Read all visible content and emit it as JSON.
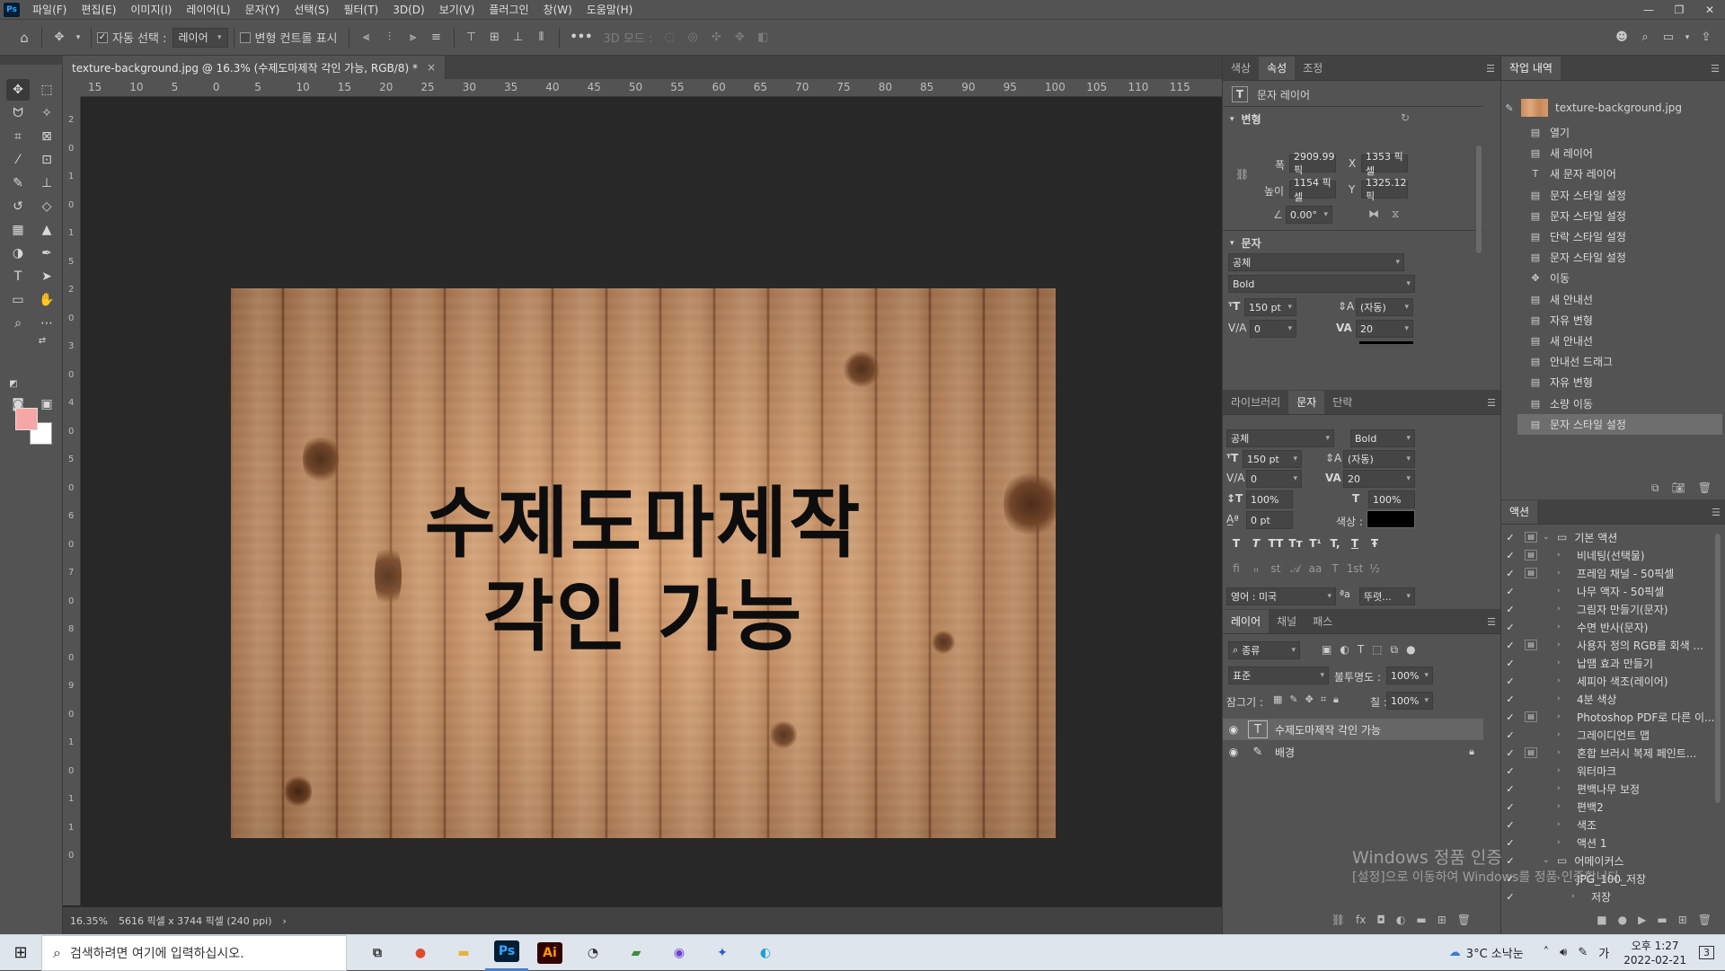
{
  "menubar": {
    "logo": "Ps",
    "items": [
      "파일(F)",
      "편집(E)",
      "이미지(I)",
      "레이어(L)",
      "문자(Y)",
      "선택(S)",
      "필터(T)",
      "3D(D)",
      "보기(V)",
      "플러그인",
      "창(W)",
      "도움말(H)"
    ],
    "win_min": "—",
    "win_restore": "❐",
    "win_close": "✕"
  },
  "options": {
    "auto_select_label": "자동 선택 :",
    "auto_select_value": "레이어",
    "transform_controls_label": "변형 컨트롤 표시",
    "more": "•••",
    "mode_3d": "3D 모드 :"
  },
  "document": {
    "tab_title": "texture-background.jpg @ 16.3% (수제도마제작 각인 가능, RGB/8) *",
    "tab_close": "×",
    "canvas_text_line1": "수제도마제작",
    "canvas_text_line2": "각인 가능",
    "ruler_h": [
      "15",
      "10",
      "5",
      "0",
      "5",
      "10",
      "15",
      "20",
      "25",
      "30",
      "35",
      "40",
      "45",
      "50",
      "55",
      "60",
      "65",
      "70",
      "75",
      "80",
      "85",
      "90",
      "95",
      "100",
      "105",
      "110",
      "115"
    ],
    "ruler_v": [
      "2",
      "0",
      "1",
      "0",
      "1",
      "5",
      "2",
      "0",
      "3",
      "0",
      "4",
      "0",
      "5",
      "0",
      "6",
      "0",
      "7",
      "0",
      "8",
      "0",
      "9",
      "0",
      "1",
      "0",
      "1",
      "1",
      "0"
    ]
  },
  "status": {
    "zoom": "16.35%",
    "size": "5616 픽셀 x 3744 픽셀 (240 ppi)",
    "arrow": "›"
  },
  "properties": {
    "tabs": [
      "색상",
      "속성",
      "조정"
    ],
    "active_tab": "속성",
    "type_label": "문자 레이어",
    "transform_header": "변형",
    "w_label": "폭",
    "w_value": "2909.99 픽",
    "h_label": "높이",
    "h_value": "1154 픽셀",
    "x_label": "X",
    "x_value": "1353 픽셀",
    "y_label": "Y",
    "y_value": "1325.12 픽",
    "angle_value": "0.00°",
    "text_header": "문자",
    "font_family": "공체",
    "font_style": "Bold",
    "font_size": "150 pt",
    "leading": "(자동)",
    "kerning": "0",
    "tracking": "20"
  },
  "character": {
    "tabs": [
      "라이브러리",
      "문자",
      "단락"
    ],
    "active_tab": "문자",
    "font_family": "공체",
    "font_style": "Bold",
    "font_size": "150 pt",
    "leading": "(자동)",
    "kerning": "0",
    "tracking": "20",
    "vscale": "100%",
    "hscale": "100%",
    "baseline": "0 pt",
    "color_label": "색상 :",
    "color": "#000000",
    "language": "영어 : 미국",
    "aa_label": "ªa",
    "antialias": "뚜렷...",
    "fmt_buttons": [
      "T",
      "T",
      "TT",
      "Tт",
      "T¹",
      "T,",
      "T",
      "Ŧ"
    ],
    "ot_buttons": [
      "fi",
      "ℴ",
      "st",
      "𝒜",
      "aa",
      "T",
      "1st",
      "½"
    ]
  },
  "layers": {
    "tabs": [
      "레이어",
      "채널",
      "패스"
    ],
    "active_tab": "레이어",
    "filter_label": "종류",
    "blend_mode": "표준",
    "opacity_label": "불투명도 :",
    "opacity": "100%",
    "lock_label": "잠그기 :",
    "fill_label": "칠 :",
    "fill": "100%",
    "items": [
      {
        "name": "수제도마제작 각인 가능",
        "kind": "T"
      },
      {
        "name": "배경",
        "kind": "✎"
      }
    ]
  },
  "history": {
    "tab": "작업 내역",
    "snapshot": "texture-background.jpg",
    "items": [
      {
        "label": "열기",
        "icon": "▤"
      },
      {
        "label": "새 레이어",
        "icon": "▤"
      },
      {
        "label": "새 문자 레이어",
        "icon": "T"
      },
      {
        "label": "문자 스타일 설정",
        "icon": "▤"
      },
      {
        "label": "문자 스타일 설정",
        "icon": "▤"
      },
      {
        "label": "단락 스타일 설정",
        "icon": "▤"
      },
      {
        "label": "문자 스타일 설정",
        "icon": "▤"
      },
      {
        "label": "이동",
        "icon": "✥"
      },
      {
        "label": "새 안내선",
        "icon": "▤"
      },
      {
        "label": "자유 변형",
        "icon": "▤"
      },
      {
        "label": "새 안내선",
        "icon": "▤"
      },
      {
        "label": "안내선 드래그",
        "icon": "▤"
      },
      {
        "label": "자유 변형",
        "icon": "▤"
      },
      {
        "label": "소량 이동",
        "icon": "▤"
      },
      {
        "label": "문자 스타일 설정",
        "icon": "▤"
      }
    ]
  },
  "actions": {
    "tab": "액션",
    "items": [
      {
        "label": "기본 액션",
        "level": 0,
        "folder": true,
        "dlg": true,
        "open": true
      },
      {
        "label": "비네팅(선택물)",
        "level": 1,
        "dlg": true
      },
      {
        "label": "프레임 채널 - 50픽셀",
        "level": 1,
        "dlg": true
      },
      {
        "label": "나무 액자 - 50픽셀",
        "level": 1,
        "dlg": false
      },
      {
        "label": "그림자 만들기(문자)",
        "level": 1,
        "dlg": false
      },
      {
        "label": "수면 반사(문자)",
        "level": 1,
        "dlg": false
      },
      {
        "label": "사용자 정의 RGB를 회색 ...",
        "level": 1,
        "dlg": true
      },
      {
        "label": "납땜 효과 만들기",
        "level": 1,
        "dlg": false
      },
      {
        "label": "세피아 색조(레이어)",
        "level": 1,
        "dlg": false
      },
      {
        "label": "4분 색상",
        "level": 1,
        "dlg": false
      },
      {
        "label": "Photoshop PDF로 다른 이...",
        "level": 1,
        "dlg": true
      },
      {
        "label": "그레이디언트 맵",
        "level": 1,
        "dlg": false
      },
      {
        "label": "혼합 브러시 복제 페인트...",
        "level": 1,
        "dlg": true
      },
      {
        "label": "워터마크",
        "level": 1,
        "dlg": false
      },
      {
        "label": "편백나무 보정",
        "level": 1,
        "dlg": false
      },
      {
        "label": "편백2",
        "level": 1,
        "dlg": false
      },
      {
        "label": "색조",
        "level": 1,
        "dlg": false
      },
      {
        "label": "액션 1",
        "level": 1,
        "dlg": false
      },
      {
        "label": "어메이커스",
        "level": 0,
        "folder": true,
        "dlg": false,
        "open": true
      },
      {
        "label": "JPG_100_저장",
        "level": 1,
        "dlg": false
      },
      {
        "label": "저장",
        "level": 2,
        "dlg": false
      }
    ]
  },
  "watermark": {
    "line1": "Windows 정품 인증",
    "line2": "[설정]으로 이동하여 Windows를 정품 인증합니다."
  },
  "taskbar": {
    "search_placeholder": "검색하려면 여기에 입력하십시오.",
    "weather": "3°C 소낙눈",
    "ime": "가",
    "time": "오후 1:27",
    "date": "2022-02-21",
    "notif": "3",
    "apps": [
      "⧉",
      "●",
      "▬",
      "Ps",
      "Ai",
      "◔",
      "▰",
      "◉",
      "✦",
      "◐"
    ]
  }
}
